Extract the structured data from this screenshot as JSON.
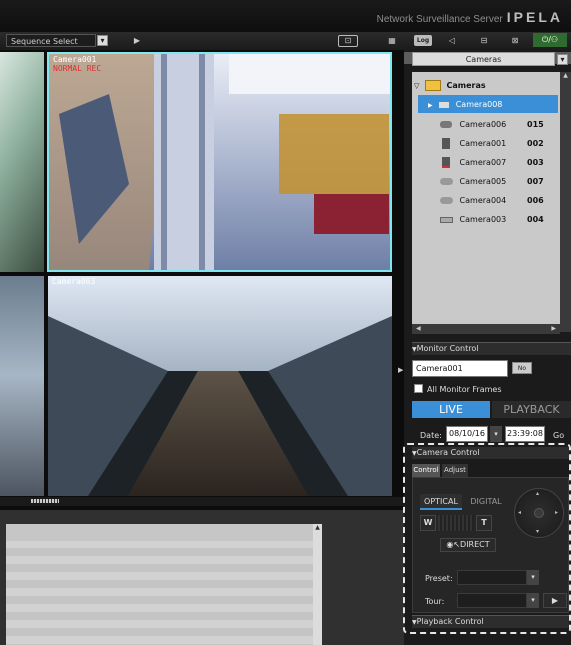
{
  "header": {
    "brand_text": "Network Surveillance Server",
    "brand_logo": "IPELA"
  },
  "toolbar": {
    "sequence_select": "Sequence Select",
    "log_label": "Log",
    "icons": [
      "play-icon",
      "camera-switch-icon",
      "snapshot-icon",
      "log-icon",
      "speaker-icon",
      "toolbox-icon",
      "screen-icon",
      "logout-icon"
    ]
  },
  "monitors": [
    {
      "label": "Camera001",
      "status": "NORMAL REC",
      "selected": true
    },
    {
      "label": "Camera003",
      "status": "",
      "selected": false
    }
  ],
  "cameras_panel": {
    "dropdown_label": "Cameras",
    "root": "Cameras",
    "items": [
      {
        "name": "Camera008",
        "number": "",
        "selected": true
      },
      {
        "name": "Camera006",
        "number": "015"
      },
      {
        "name": "Camera001",
        "number": "002"
      },
      {
        "name": "Camera007",
        "number": "003"
      },
      {
        "name": "Camera005",
        "number": "007"
      },
      {
        "name": "Camera004",
        "number": "006"
      },
      {
        "name": "Camera003",
        "number": "004"
      }
    ]
  },
  "monitor_control": {
    "header": "Monitor Control",
    "camera_field": "Camera001",
    "no_label": "No",
    "all_monitor_frames": "All Monitor Frames",
    "live": "LIVE",
    "playback": "PLAYBACK",
    "date_label": "Date:",
    "date_value": "08/10/16",
    "time_value": "23:39:08",
    "go_label": "Go"
  },
  "camera_control": {
    "header": "Camera Control",
    "tab_control": "Control",
    "tab_adjust": "Adjust",
    "optical": "OPTICAL",
    "digital": "DIGITAL",
    "wide": "W",
    "tele": "T",
    "direct": "DIRECT",
    "preset_label": "Preset:",
    "tour_label": "Tour:"
  },
  "playback_control": {
    "header": "Playback Control"
  },
  "colors": {
    "accent": "#3a8fd6",
    "selection_border": "#7fe7ef",
    "rec_text": "#e03030"
  }
}
